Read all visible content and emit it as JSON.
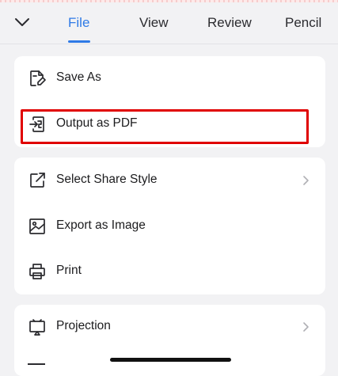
{
  "tabs": [
    {
      "label": "File",
      "active": true
    },
    {
      "label": "View",
      "active": false
    },
    {
      "label": "Review",
      "active": false
    },
    {
      "label": "Pencil",
      "active": false
    }
  ],
  "menu": {
    "group1": [
      {
        "label": "Save As",
        "icon": "save-as-icon"
      },
      {
        "label": "Output as PDF",
        "icon": "pdf-export-icon",
        "highlighted": true
      }
    ],
    "group2": [
      {
        "label": "Select Share Style",
        "icon": "share-icon",
        "has_submenu": true
      },
      {
        "label": "Export as Image",
        "icon": "image-icon"
      },
      {
        "label": "Print",
        "icon": "printer-icon"
      }
    ],
    "group3": [
      {
        "label": "Projection",
        "icon": "projection-icon",
        "has_submenu": true
      }
    ]
  },
  "colors": {
    "accent": "#2f7ae6",
    "highlight_border": "#e00000",
    "background": "#f2f2f4",
    "card": "#ffffff"
  }
}
